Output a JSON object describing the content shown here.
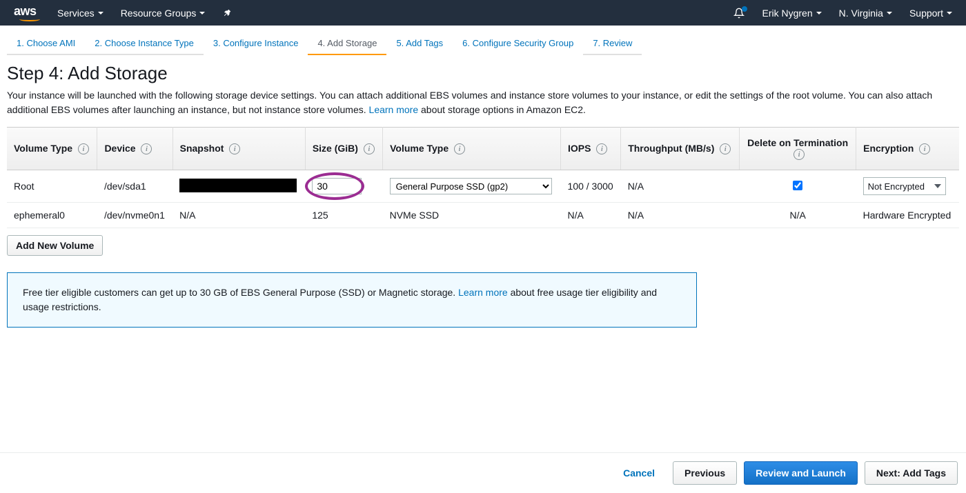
{
  "topnav": {
    "logo": "aws",
    "services": "Services",
    "resource_groups": "Resource Groups",
    "user": "Erik Nygren",
    "region": "N. Virginia",
    "support": "Support"
  },
  "tabs": {
    "t1": "1. Choose AMI",
    "t2": "2. Choose Instance Type",
    "t3": "3. Configure Instance",
    "t4": "4. Add Storage",
    "t5": "5. Add Tags",
    "t6": "6. Configure Security Group",
    "t7": "7. Review"
  },
  "page": {
    "title": "Step 4: Add Storage",
    "desc1": "Your instance will be launched with the following storage device settings. You can attach additional EBS volumes and instance store volumes to your instance, or edit the settings of the root volume. You can also attach additional EBS volumes after launching an instance, but not instance store volumes. ",
    "learn_more": "Learn more",
    "desc2": " about storage options in Amazon EC2."
  },
  "table": {
    "headers": {
      "col1": "Volume Type",
      "col2": "Device",
      "col3": "Snapshot",
      "col4": "Size (GiB)",
      "col5": "Volume Type",
      "col6": "IOPS",
      "col7": "Throughput (MB/s)",
      "col8": "Delete on Termination",
      "col9": "Encryption"
    },
    "row0": {
      "voltype": "Root",
      "device": "/dev/sda1",
      "snapshot": "",
      "size": "30",
      "voltype2": "General Purpose SSD (gp2)",
      "iops": "100 / 3000",
      "throughput": "N/A",
      "encryption": "Not Encrypted"
    },
    "row1": {
      "voltype": "ephemeral0",
      "device": "/dev/nvme0n1",
      "snapshot": "N/A",
      "size": "125",
      "voltype2": "NVMe SSD",
      "iops": "N/A",
      "throughput": "N/A",
      "delete": "N/A",
      "encryption": "Hardware Encrypted"
    }
  },
  "add_volume": "Add New Volume",
  "infobox": {
    "text1": "Free tier eligible customers can get up to 30 GB of EBS General Purpose (SSD) or Magnetic storage. ",
    "learn_more": "Learn more",
    "text2": " about free usage tier eligibility and usage restrictions."
  },
  "footer": {
    "cancel": "Cancel",
    "previous": "Previous",
    "review": "Review and Launch",
    "next": "Next: Add Tags"
  }
}
